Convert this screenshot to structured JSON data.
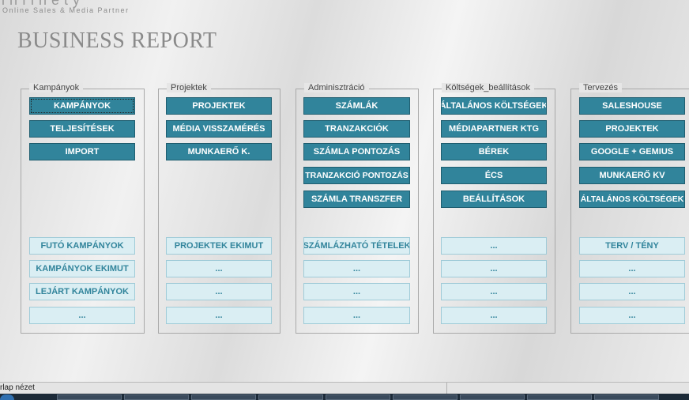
{
  "logo": {
    "word": "infinety",
    "tagline": "Online Sales & Media Partner"
  },
  "title": "BUSINESS REPORT",
  "groups": [
    {
      "label": "Kampányok",
      "dark": [
        "KAMPÁNYOK",
        "TELJESÍTÉSEK",
        "IMPORT"
      ],
      "light": [
        "FUTÓ KAMPÁNYOK",
        "KAMPÁNYOK EKIMUT",
        "LEJÁRT KAMPÁNYOK",
        "..."
      ]
    },
    {
      "label": "Projektek",
      "dark": [
        "PROJEKTEK",
        "MÉDIA VISSZAMÉRÉS",
        "MUNKAERŐ K."
      ],
      "light": [
        "PROJEKTEK EKIMUT",
        "...",
        "...",
        "..."
      ]
    },
    {
      "label": "Adminisztráció",
      "dark": [
        "SZÁMLÁK",
        "TRANZAKCIÓK",
        "SZÁMLA PONTOZÁS",
        "TRANZAKCIÓ PONTOZÁS",
        "SZÁMLA TRANSZFER"
      ],
      "light": [
        "SZÁMLÁZHATÓ TÉTELEK",
        "...",
        "...",
        "..."
      ]
    },
    {
      "label": "Költségek_beállítások",
      "dark": [
        "ÁLTALÁNOS KÖLTSÉGEK",
        "MÉDIAPARTNER KTG",
        "BÉREK",
        "ÉCS",
        "BEÁLLÍTÁSOK"
      ],
      "light": [
        "...",
        "...",
        "...",
        "..."
      ]
    },
    {
      "label": "Tervezés",
      "dark": [
        "SALESHOUSE",
        "PROJEKTEK",
        "GOOGLE + GEMIUS",
        "MUNKAERŐ KV",
        "ÁLTALÁNOS KÖLTSÉGEK"
      ],
      "light": [
        "TERV / TÉNY",
        "...",
        "...",
        "..."
      ]
    }
  ],
  "status": {
    "text": "rlap nézet"
  }
}
